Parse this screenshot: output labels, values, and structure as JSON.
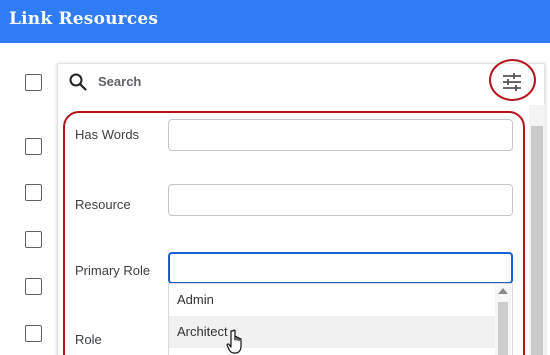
{
  "header": {
    "title": "Link Resources"
  },
  "search": {
    "placeholder": "Search",
    "icon": "search-icon",
    "filter_icon": "tune-sliders-icon"
  },
  "filters": {
    "has_words": {
      "label": "Has Words",
      "value": ""
    },
    "resource": {
      "label": "Resource",
      "value": ""
    },
    "primary_role": {
      "label": "Primary Role",
      "value": "",
      "options": [
        "Admin",
        "Architect"
      ]
    },
    "role": {
      "label": "Role"
    }
  },
  "colors": {
    "header": "#2f7cf6",
    "highlight": "#b3151c",
    "focus": "#1a5fd8"
  }
}
